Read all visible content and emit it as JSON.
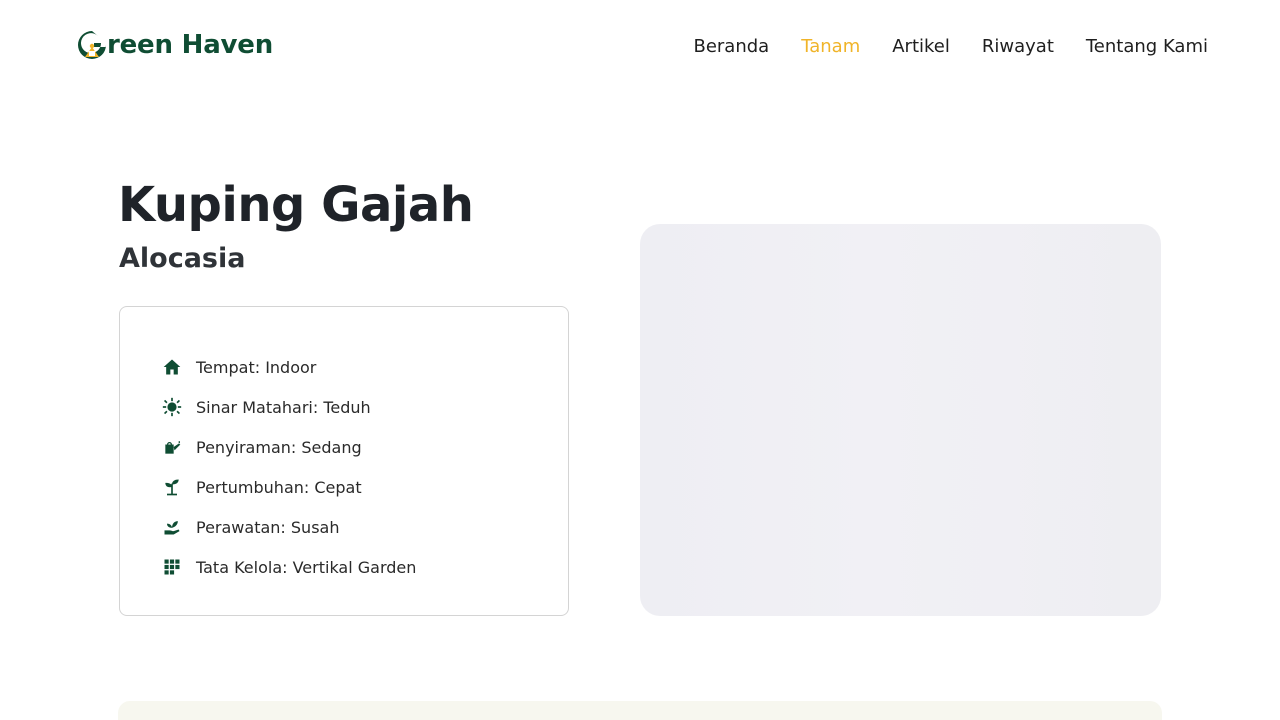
{
  "brand": {
    "name": "reen Haven",
    "logo_icon": "leaf-g-logo",
    "primary_color": "#0f4d33",
    "accent_color": "#f0b429"
  },
  "nav": {
    "items": [
      {
        "label": "Beranda",
        "active": false
      },
      {
        "label": "Tanam",
        "active": true
      },
      {
        "label": "Artikel",
        "active": false
      },
      {
        "label": "Riwayat",
        "active": false
      },
      {
        "label": "Tentang Kami",
        "active": false
      }
    ]
  },
  "plant": {
    "title": "Kuping Gajah",
    "subtitle": "Alocasia",
    "details": [
      {
        "icon": "house-icon",
        "text": "Tempat: Indoor"
      },
      {
        "icon": "sun-icon",
        "text": "Sinar Matahari: Teduh"
      },
      {
        "icon": "watering-can-icon",
        "text": "Penyiraman: Sedang"
      },
      {
        "icon": "seedling-icon",
        "text": "Pertumbuhan: Cepat"
      },
      {
        "icon": "hand-plant-icon",
        "text": "Perawatan: Susah"
      },
      {
        "icon": "grid-icon",
        "text": "Tata Kelola: Vertikal Garden"
      }
    ]
  },
  "colors": {
    "image_placeholder": "#efeff4",
    "bottom_section": "#f7f7ef"
  }
}
